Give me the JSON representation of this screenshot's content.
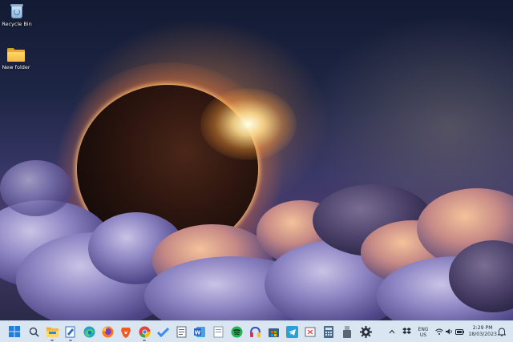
{
  "desktop": {
    "icons": [
      {
        "label": "Recycle Bin",
        "icon": "recycle-bin-icon"
      },
      {
        "label": "New folder",
        "icon": "folder-icon"
      }
    ]
  },
  "taskbar": {
    "apps": [
      {
        "name": "start",
        "icon": "windows-start-icon",
        "color": "#1f7fe0"
      },
      {
        "name": "search",
        "icon": "search-icon",
        "color": "#3b4a5c"
      },
      {
        "name": "file-explorer",
        "icon": "folder-icon",
        "color": "#f2b93e"
      },
      {
        "name": "app-4",
        "icon": "pen-doc-icon",
        "color": "#2f6fc0"
      },
      {
        "name": "edge",
        "icon": "edge-icon",
        "color": "#1fa4c9"
      },
      {
        "name": "firefox",
        "icon": "firefox-icon",
        "color": "#ff7a1a"
      },
      {
        "name": "brave",
        "icon": "brave-icon",
        "color": "#f05a24"
      },
      {
        "name": "chrome",
        "icon": "chrome-icon",
        "color": "#e2433b"
      },
      {
        "name": "todo",
        "icon": "check-icon",
        "color": "#3d8bf0"
      },
      {
        "name": "app-10",
        "icon": "notepad-icon",
        "color": "#ffffff"
      },
      {
        "name": "word",
        "icon": "word-icon",
        "color": "#2b5eb8"
      },
      {
        "name": "app-12",
        "icon": "document-icon",
        "color": "#ffffff"
      },
      {
        "name": "spotify",
        "icon": "spotify-icon",
        "color": "#1db954"
      },
      {
        "name": "app-14",
        "icon": "headphones-icon",
        "color": "#d6345f"
      },
      {
        "name": "app-15",
        "icon": "store-icon",
        "color": "#355f8f"
      },
      {
        "name": "telegram",
        "icon": "telegram-icon",
        "color": "#2aa0d8"
      },
      {
        "name": "app-17",
        "icon": "snip-icon",
        "color": "#ffffff"
      },
      {
        "name": "calculator",
        "icon": "calculator-icon",
        "color": "#4a6a8a"
      },
      {
        "name": "app-19",
        "icon": "usb-icon",
        "color": "#5a6675"
      },
      {
        "name": "settings",
        "icon": "gear-icon",
        "color": "#2a2f38"
      }
    ],
    "tray": {
      "language": "ENG",
      "region": "US",
      "time": "2:29 PM",
      "date": "18/03/2023"
    }
  }
}
